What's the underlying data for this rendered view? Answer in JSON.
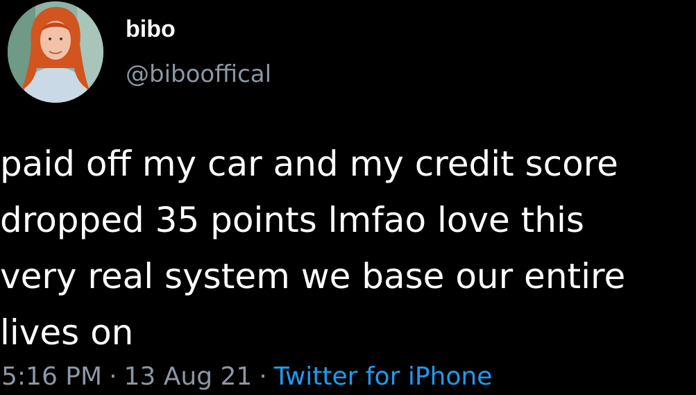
{
  "user": {
    "display_name": "bibo",
    "handle": "@bibooffical",
    "avatar_icon": "profile-photo"
  },
  "tweet": {
    "lines": [
      "paid off my car and my credit score",
      "dropped 35 points lmfao love this",
      "very real system we base our entire",
      "lives on"
    ],
    "time": "5:16 PM",
    "separator": "·",
    "date": "13 Aug 21",
    "source": "Twitter for iPhone"
  },
  "colors": {
    "background": "#000000",
    "text": "#ffffff",
    "secondary": "#8b98a5",
    "link": "#1d9bf0"
  }
}
